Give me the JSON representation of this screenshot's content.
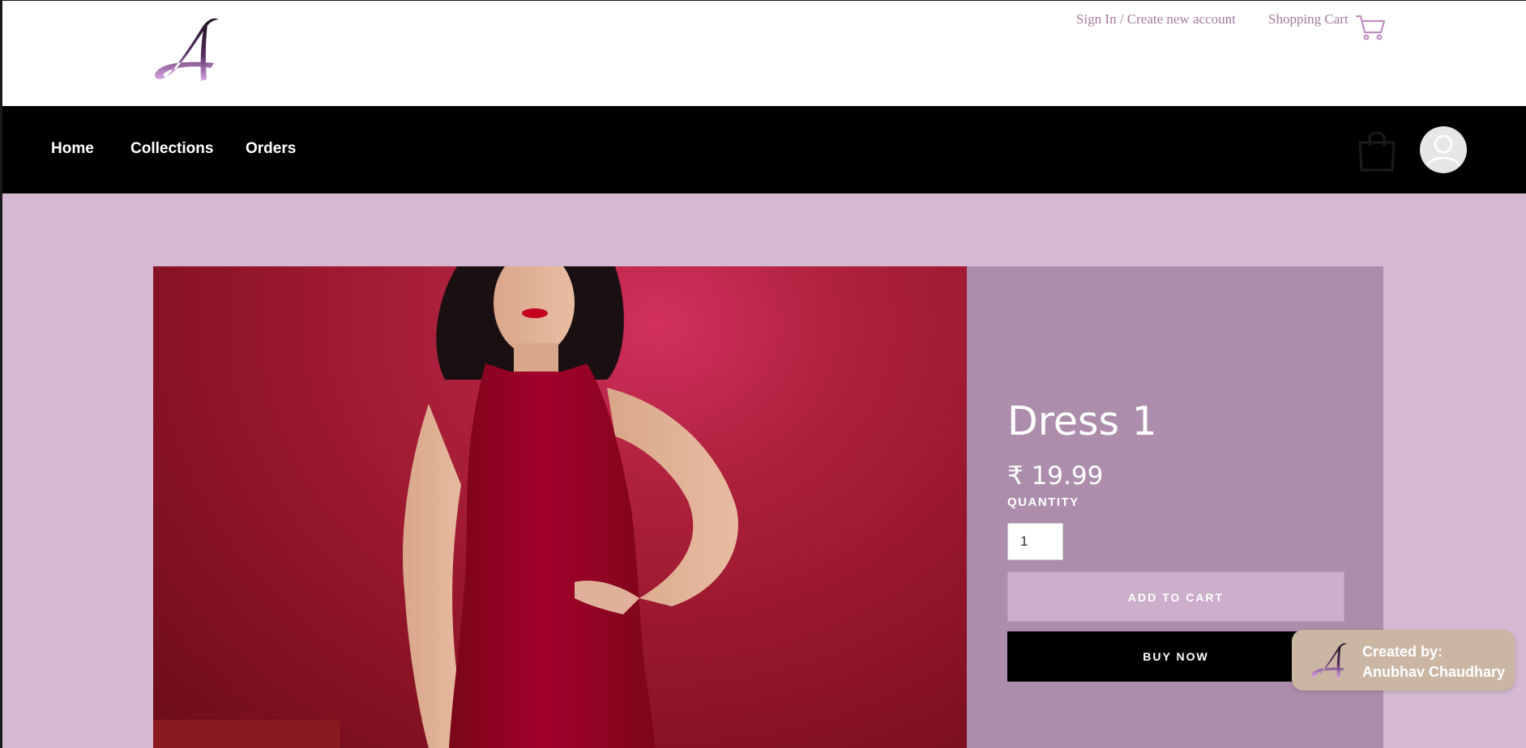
{
  "header": {
    "signin_label": "Sign In / Create new account",
    "cart_label": "Shopping Cart"
  },
  "nav": {
    "items": [
      {
        "label": "Home"
      },
      {
        "label": "Collections"
      },
      {
        "label": "Orders"
      }
    ]
  },
  "product": {
    "title": "Dress 1",
    "price": "₹ 19.99",
    "quantity_label": "QUANTITY",
    "quantity_value": "1",
    "add_to_cart_label": "ADD TO CART",
    "buy_now_label": "BUY NOW"
  },
  "credit": {
    "line1": "Created by:",
    "line2": "Anubhav Chaudhary"
  },
  "colors": {
    "page_bg": "#d5b9d2",
    "nav_bg": "#000000",
    "panel_bg": "#ad8dac",
    "accent": "#a37c9c",
    "badge_bg": "#cab6a3"
  },
  "icons": [
    "logo-icon",
    "cart-icon",
    "bag-icon",
    "avatar-icon"
  ]
}
